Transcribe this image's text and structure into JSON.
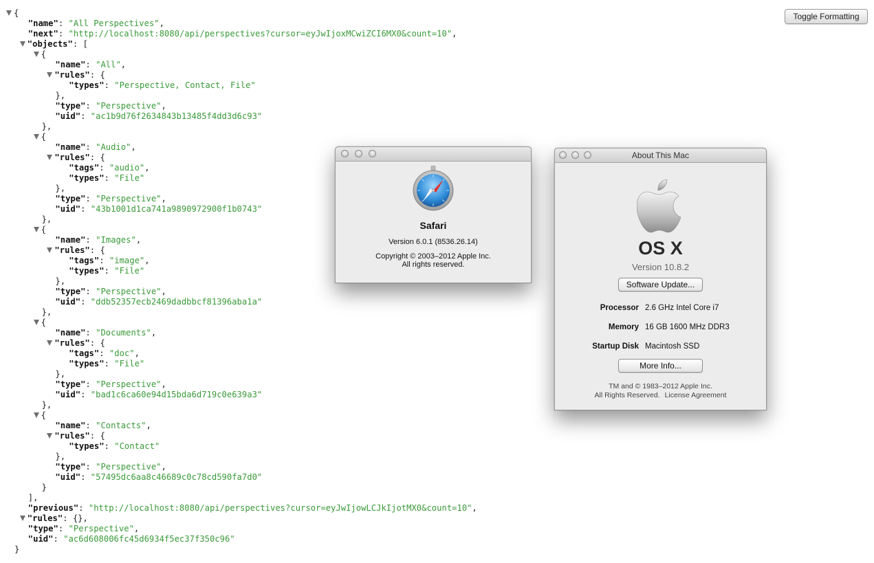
{
  "json_viewer": {
    "toggle_button": "Toggle Formatting",
    "lines": [
      {
        "indent": 0,
        "tri": true,
        "tokens": [
          [
            "p",
            "{"
          ]
        ]
      },
      {
        "indent": 2,
        "tri": false,
        "tokens": [
          [
            "k",
            "\"name\""
          ],
          [
            "p",
            ": "
          ],
          [
            "s",
            "\"All Perspectives\""
          ],
          [
            "p",
            ","
          ]
        ]
      },
      {
        "indent": 2,
        "tri": false,
        "tokens": [
          [
            "k",
            "\"next\""
          ],
          [
            "p",
            ": "
          ],
          [
            "s",
            "\"http://localhost:8080/api/perspectives?cursor=eyJwIjoxMCwiZCI6MX0&count=10\""
          ],
          [
            "p",
            ","
          ]
        ]
      },
      {
        "indent": 2,
        "tri": true,
        "tokens": [
          [
            "k",
            "\"objects\""
          ],
          [
            "p",
            ": ["
          ]
        ]
      },
      {
        "indent": 4,
        "tri": true,
        "tokens": [
          [
            "p",
            "{"
          ]
        ]
      },
      {
        "indent": 6,
        "tri": false,
        "tokens": [
          [
            "k",
            "\"name\""
          ],
          [
            "p",
            ": "
          ],
          [
            "s",
            "\"All\""
          ],
          [
            "p",
            ","
          ]
        ]
      },
      {
        "indent": 6,
        "tri": true,
        "tokens": [
          [
            "k",
            "\"rules\""
          ],
          [
            "p",
            ": {"
          ]
        ]
      },
      {
        "indent": 8,
        "tri": false,
        "tokens": [
          [
            "k",
            "\"types\""
          ],
          [
            "p",
            ": "
          ],
          [
            "s",
            "\"Perspective, Contact, File\""
          ]
        ]
      },
      {
        "indent": 6,
        "tri": false,
        "tokens": [
          [
            "p",
            "},"
          ]
        ]
      },
      {
        "indent": 6,
        "tri": false,
        "tokens": [
          [
            "k",
            "\"type\""
          ],
          [
            "p",
            ": "
          ],
          [
            "s",
            "\"Perspective\""
          ],
          [
            "p",
            ","
          ]
        ]
      },
      {
        "indent": 6,
        "tri": false,
        "tokens": [
          [
            "k",
            "\"uid\""
          ],
          [
            "p",
            ": "
          ],
          [
            "s",
            "\"ac1b9d76f2634843b13485f4dd3d6c93\""
          ]
        ]
      },
      {
        "indent": 4,
        "tri": false,
        "tokens": [
          [
            "p",
            "},"
          ]
        ]
      },
      {
        "indent": 4,
        "tri": true,
        "tokens": [
          [
            "p",
            "{"
          ]
        ]
      },
      {
        "indent": 6,
        "tri": false,
        "tokens": [
          [
            "k",
            "\"name\""
          ],
          [
            "p",
            ": "
          ],
          [
            "s",
            "\"Audio\""
          ],
          [
            "p",
            ","
          ]
        ]
      },
      {
        "indent": 6,
        "tri": true,
        "tokens": [
          [
            "k",
            "\"rules\""
          ],
          [
            "p",
            ": {"
          ]
        ]
      },
      {
        "indent": 8,
        "tri": false,
        "tokens": [
          [
            "k",
            "\"tags\""
          ],
          [
            "p",
            ": "
          ],
          [
            "s",
            "\"audio\""
          ],
          [
            "p",
            ","
          ]
        ]
      },
      {
        "indent": 8,
        "tri": false,
        "tokens": [
          [
            "k",
            "\"types\""
          ],
          [
            "p",
            ": "
          ],
          [
            "s",
            "\"File\""
          ]
        ]
      },
      {
        "indent": 6,
        "tri": false,
        "tokens": [
          [
            "p",
            "},"
          ]
        ]
      },
      {
        "indent": 6,
        "tri": false,
        "tokens": [
          [
            "k",
            "\"type\""
          ],
          [
            "p",
            ": "
          ],
          [
            "s",
            "\"Perspective\""
          ],
          [
            "p",
            ","
          ]
        ]
      },
      {
        "indent": 6,
        "tri": false,
        "tokens": [
          [
            "k",
            "\"uid\""
          ],
          [
            "p",
            ": "
          ],
          [
            "s",
            "\"43b1001d1ca741a9890972900f1b0743\""
          ]
        ]
      },
      {
        "indent": 4,
        "tri": false,
        "tokens": [
          [
            "p",
            "},"
          ]
        ]
      },
      {
        "indent": 4,
        "tri": true,
        "tokens": [
          [
            "p",
            "{"
          ]
        ]
      },
      {
        "indent": 6,
        "tri": false,
        "tokens": [
          [
            "k",
            "\"name\""
          ],
          [
            "p",
            ": "
          ],
          [
            "s",
            "\"Images\""
          ],
          [
            "p",
            ","
          ]
        ]
      },
      {
        "indent": 6,
        "tri": true,
        "tokens": [
          [
            "k",
            "\"rules\""
          ],
          [
            "p",
            ": {"
          ]
        ]
      },
      {
        "indent": 8,
        "tri": false,
        "tokens": [
          [
            "k",
            "\"tags\""
          ],
          [
            "p",
            ": "
          ],
          [
            "s",
            "\"image\""
          ],
          [
            "p",
            ","
          ]
        ]
      },
      {
        "indent": 8,
        "tri": false,
        "tokens": [
          [
            "k",
            "\"types\""
          ],
          [
            "p",
            ": "
          ],
          [
            "s",
            "\"File\""
          ]
        ]
      },
      {
        "indent": 6,
        "tri": false,
        "tokens": [
          [
            "p",
            "},"
          ]
        ]
      },
      {
        "indent": 6,
        "tri": false,
        "tokens": [
          [
            "k",
            "\"type\""
          ],
          [
            "p",
            ": "
          ],
          [
            "s",
            "\"Perspective\""
          ],
          [
            "p",
            ","
          ]
        ]
      },
      {
        "indent": 6,
        "tri": false,
        "tokens": [
          [
            "k",
            "\"uid\""
          ],
          [
            "p",
            ": "
          ],
          [
            "s",
            "\"ddb52357ecb2469dadbbcf81396aba1a\""
          ]
        ]
      },
      {
        "indent": 4,
        "tri": false,
        "tokens": [
          [
            "p",
            "},"
          ]
        ]
      },
      {
        "indent": 4,
        "tri": true,
        "tokens": [
          [
            "p",
            "{"
          ]
        ]
      },
      {
        "indent": 6,
        "tri": false,
        "tokens": [
          [
            "k",
            "\"name\""
          ],
          [
            "p",
            ": "
          ],
          [
            "s",
            "\"Documents\""
          ],
          [
            "p",
            ","
          ]
        ]
      },
      {
        "indent": 6,
        "tri": true,
        "tokens": [
          [
            "k",
            "\"rules\""
          ],
          [
            "p",
            ": {"
          ]
        ]
      },
      {
        "indent": 8,
        "tri": false,
        "tokens": [
          [
            "k",
            "\"tags\""
          ],
          [
            "p",
            ": "
          ],
          [
            "s",
            "\"doc\""
          ],
          [
            "p",
            ","
          ]
        ]
      },
      {
        "indent": 8,
        "tri": false,
        "tokens": [
          [
            "k",
            "\"types\""
          ],
          [
            "p",
            ": "
          ],
          [
            "s",
            "\"File\""
          ]
        ]
      },
      {
        "indent": 6,
        "tri": false,
        "tokens": [
          [
            "p",
            "},"
          ]
        ]
      },
      {
        "indent": 6,
        "tri": false,
        "tokens": [
          [
            "k",
            "\"type\""
          ],
          [
            "p",
            ": "
          ],
          [
            "s",
            "\"Perspective\""
          ],
          [
            "p",
            ","
          ]
        ]
      },
      {
        "indent": 6,
        "tri": false,
        "tokens": [
          [
            "k",
            "\"uid\""
          ],
          [
            "p",
            ": "
          ],
          [
            "s",
            "\"bad1c6ca60e94d15bda6d719c0e639a3\""
          ]
        ]
      },
      {
        "indent": 4,
        "tri": false,
        "tokens": [
          [
            "p",
            "},"
          ]
        ]
      },
      {
        "indent": 4,
        "tri": true,
        "tokens": [
          [
            "p",
            "{"
          ]
        ]
      },
      {
        "indent": 6,
        "tri": false,
        "tokens": [
          [
            "k",
            "\"name\""
          ],
          [
            "p",
            ": "
          ],
          [
            "s",
            "\"Contacts\""
          ],
          [
            "p",
            ","
          ]
        ]
      },
      {
        "indent": 6,
        "tri": true,
        "tokens": [
          [
            "k",
            "\"rules\""
          ],
          [
            "p",
            ": {"
          ]
        ]
      },
      {
        "indent": 8,
        "tri": false,
        "tokens": [
          [
            "k",
            "\"types\""
          ],
          [
            "p",
            ": "
          ],
          [
            "s",
            "\"Contact\""
          ]
        ]
      },
      {
        "indent": 6,
        "tri": false,
        "tokens": [
          [
            "p",
            "},"
          ]
        ]
      },
      {
        "indent": 6,
        "tri": false,
        "tokens": [
          [
            "k",
            "\"type\""
          ],
          [
            "p",
            ": "
          ],
          [
            "s",
            "\"Perspective\""
          ],
          [
            "p",
            ","
          ]
        ]
      },
      {
        "indent": 6,
        "tri": false,
        "tokens": [
          [
            "k",
            "\"uid\""
          ],
          [
            "p",
            ": "
          ],
          [
            "s",
            "\"57495dc6aa8c46689c0c78cd590fa7d0\""
          ]
        ]
      },
      {
        "indent": 4,
        "tri": false,
        "tokens": [
          [
            "p",
            "}"
          ]
        ]
      },
      {
        "indent": 2,
        "tri": false,
        "tokens": [
          [
            "p",
            "],"
          ]
        ]
      },
      {
        "indent": 2,
        "tri": false,
        "tokens": [
          [
            "k",
            "\"previous\""
          ],
          [
            "p",
            ": "
          ],
          [
            "s",
            "\"http://localhost:8080/api/perspectives?cursor=eyJwIjowLCJkIjotMX0&count=10\""
          ],
          [
            "p",
            ","
          ]
        ]
      },
      {
        "indent": 2,
        "tri": true,
        "tokens": [
          [
            "k",
            "\"rules\""
          ],
          [
            "p",
            ": {},"
          ]
        ]
      },
      {
        "indent": 2,
        "tri": false,
        "tokens": [
          [
            "k",
            "\"type\""
          ],
          [
            "p",
            ": "
          ],
          [
            "s",
            "\"Perspective\""
          ],
          [
            "p",
            ","
          ]
        ]
      },
      {
        "indent": 2,
        "tri": false,
        "tokens": [
          [
            "k",
            "\"uid\""
          ],
          [
            "p",
            ": "
          ],
          [
            "s",
            "\"ac6d608006fc45d6934f5ec37f350c96\""
          ]
        ]
      },
      {
        "indent": 0,
        "tri": false,
        "tokens": [
          [
            "p",
            "}"
          ]
        ]
      }
    ]
  },
  "safari_about": {
    "icon": "safari-compass-icon",
    "app_name": "Safari",
    "version": "Version 6.0.1 (8536.26.14)",
    "copyright_line1": "Copyright © 2003–2012 Apple Inc.",
    "copyright_line2": "All rights reserved."
  },
  "about_mac": {
    "title": "About This Mac",
    "logo": "apple-logo",
    "os_name": "OS X",
    "os_version": "Version 10.8.2",
    "software_update_button": "Software Update...",
    "specs": [
      {
        "label": "Processor",
        "value": "2.6 GHz Intel Core i7"
      },
      {
        "label": "Memory",
        "value": "16 GB 1600 MHz DDR3"
      },
      {
        "label": "Startup Disk",
        "value": "Macintosh SSD"
      }
    ],
    "more_info_button": "More Info...",
    "footer_line1": "TM and © 1983–2012 Apple Inc.",
    "footer_line2_text": "All Rights Reserved.",
    "footer_link": "License Agreement"
  },
  "colors": {
    "json_key": "#111111",
    "json_string": "#3a9a3a",
    "window_bg": "#ececec"
  }
}
